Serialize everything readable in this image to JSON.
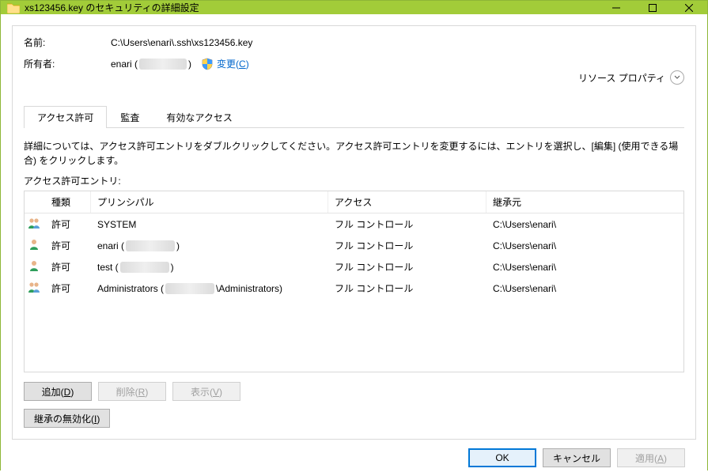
{
  "window": {
    "title": "xs123456.key のセキュリティの詳細設定"
  },
  "header": {
    "name_label": "名前:",
    "name_value": "C:\\Users\\enari\\.ssh\\xs123456.key",
    "owner_label": "所有者:",
    "owner_prefix": "enari (",
    "owner_suffix": ")",
    "change_label": "変更",
    "change_mnemonic": "C",
    "resource_properties": "リソース プロパティ"
  },
  "tabs": {
    "permissions": "アクセス許可",
    "auditing": "監査",
    "effective": "有効なアクセス"
  },
  "instructions": "詳細については、アクセス許可エントリをダブルクリックしてください。アクセス許可エントリを変更するには、エントリを選択し、[編集] (使用できる場合) をクリックします。",
  "entries_label": "アクセス許可エントリ:",
  "columns": {
    "type": "種類",
    "principal": "プリンシパル",
    "access": "アクセス",
    "inherited": "継承元"
  },
  "entries": [
    {
      "icon": "group",
      "type": "許可",
      "principal_prefix": "SYSTEM",
      "redacted": false,
      "principal_suffix": "",
      "access": "フル コントロール",
      "inherited": "C:\\Users\\enari\\"
    },
    {
      "icon": "user",
      "type": "許可",
      "principal_prefix": "enari (",
      "redacted": true,
      "principal_suffix": ")",
      "access": "フル コントロール",
      "inherited": "C:\\Users\\enari\\"
    },
    {
      "icon": "user",
      "type": "許可",
      "principal_prefix": "test (",
      "redacted": true,
      "principal_suffix": ")",
      "access": "フル コントロール",
      "inherited": "C:\\Users\\enari\\"
    },
    {
      "icon": "group",
      "type": "許可",
      "principal_prefix": "Administrators (",
      "redacted": true,
      "principal_suffix": "\\Administrators)",
      "access": "フル コントロール",
      "inherited": "C:\\Users\\enari\\"
    }
  ],
  "buttons": {
    "add": "追加",
    "add_m": "D",
    "remove": "削除",
    "remove_m": "R",
    "view": "表示",
    "view_m": "V",
    "disable_inherit": "継承の無効化",
    "disable_inherit_m": "I",
    "ok": "OK",
    "cancel": "キャンセル",
    "apply": "適用",
    "apply_m": "A"
  }
}
